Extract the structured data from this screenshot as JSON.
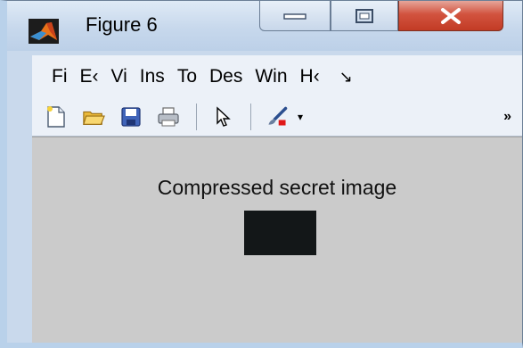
{
  "window": {
    "title": "Figure 6",
    "close_glyph": "✕"
  },
  "menubar": {
    "items": [
      "Fi",
      "E‹",
      "Vi",
      "Ins",
      "To",
      "Des",
      "Win",
      "H‹"
    ],
    "overflow": "↘"
  },
  "toolbar": {
    "icons": [
      "new-figure-icon",
      "open-file-icon",
      "save-icon",
      "print-icon",
      "pointer-icon",
      "brush-icon"
    ],
    "dropdown_glyph": "▾",
    "more_glyph": "»"
  },
  "figure": {
    "title": "Compressed secret image",
    "image_color": "#131718"
  },
  "colors": {
    "close_button": "#c23b25",
    "figure_background": "#cbcbcb"
  }
}
